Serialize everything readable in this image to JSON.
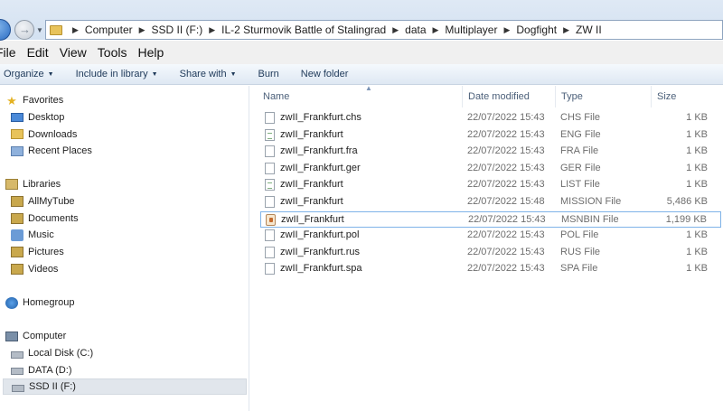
{
  "address": {
    "crumbs": [
      "Computer",
      "SSD II (F:)",
      "IL-2 Sturmovik Battle of Stalingrad",
      "data",
      "Multiplayer",
      "Dogfight",
      "ZW II"
    ]
  },
  "menu": [
    "File",
    "Edit",
    "View",
    "Tools",
    "Help"
  ],
  "commands": [
    {
      "label": "Organize",
      "dropdown": true
    },
    {
      "label": "Include in library",
      "dropdown": true
    },
    {
      "label": "Share with",
      "dropdown": true
    },
    {
      "label": "Burn",
      "dropdown": false
    },
    {
      "label": "New folder",
      "dropdown": false
    }
  ],
  "nav": {
    "favorites": {
      "label": "Favorites",
      "icon": "star-icon",
      "items": [
        {
          "label": "Desktop",
          "icon": "desktop-icon"
        },
        {
          "label": "Downloads",
          "icon": "downloads-folder-icon"
        },
        {
          "label": "Recent Places",
          "icon": "recent-places-icon"
        }
      ]
    },
    "libraries": {
      "label": "Libraries",
      "icon": "libraries-icon",
      "items": [
        {
          "label": "AllMyTube",
          "icon": "library-icon"
        },
        {
          "label": "Documents",
          "icon": "documents-library-icon"
        },
        {
          "label": "Music",
          "icon": "music-library-icon"
        },
        {
          "label": "Pictures",
          "icon": "pictures-library-icon"
        },
        {
          "label": "Videos",
          "icon": "videos-library-icon"
        }
      ]
    },
    "homegroup": {
      "label": "Homegroup",
      "icon": "homegroup-icon"
    },
    "computer": {
      "label": "Computer",
      "icon": "computer-icon",
      "items": [
        {
          "label": "Local Disk (C:)",
          "icon": "disk-icon"
        },
        {
          "label": "DATA (D:)",
          "icon": "disk-icon"
        },
        {
          "label": "SSD II (F:)",
          "icon": "disk-icon",
          "selected": true
        }
      ]
    }
  },
  "columns": {
    "name": "Name",
    "date": "Date modified",
    "type": "Type",
    "size": "Size"
  },
  "files": [
    {
      "name": "zwII_Frankfurt.chs",
      "date": "22/07/2022 15:43",
      "type": "CHS File",
      "size": "1 KB",
      "icon": "blank"
    },
    {
      "name": "zwII_Frankfurt",
      "date": "22/07/2022 15:43",
      "type": "ENG File",
      "size": "1 KB",
      "icon": "text"
    },
    {
      "name": "zwII_Frankfurt.fra",
      "date": "22/07/2022 15:43",
      "type": "FRA File",
      "size": "1 KB",
      "icon": "blank"
    },
    {
      "name": "zwII_Frankfurt.ger",
      "date": "22/07/2022 15:43",
      "type": "GER File",
      "size": "1 KB",
      "icon": "blank"
    },
    {
      "name": "zwII_Frankfurt",
      "date": "22/07/2022 15:43",
      "type": "LIST File",
      "size": "1 KB",
      "icon": "text"
    },
    {
      "name": "zwII_Frankfurt",
      "date": "22/07/2022 15:48",
      "type": "MISSION File",
      "size": "5,486 KB",
      "icon": "blank"
    },
    {
      "name": "zwII_Frankfurt",
      "date": "22/07/2022 15:43",
      "type": "MSNBIN File",
      "size": "1,199 KB",
      "icon": "app",
      "focused": true
    },
    {
      "name": "zwII_Frankfurt.pol",
      "date": "22/07/2022 15:43",
      "type": "POL File",
      "size": "1 KB",
      "icon": "blank"
    },
    {
      "name": "zwII_Frankfurt.rus",
      "date": "22/07/2022 15:43",
      "type": "RUS File",
      "size": "1 KB",
      "icon": "blank"
    },
    {
      "name": "zwII_Frankfurt.spa",
      "date": "22/07/2022 15:43",
      "type": "SPA File",
      "size": "1 KB",
      "icon": "blank"
    }
  ]
}
